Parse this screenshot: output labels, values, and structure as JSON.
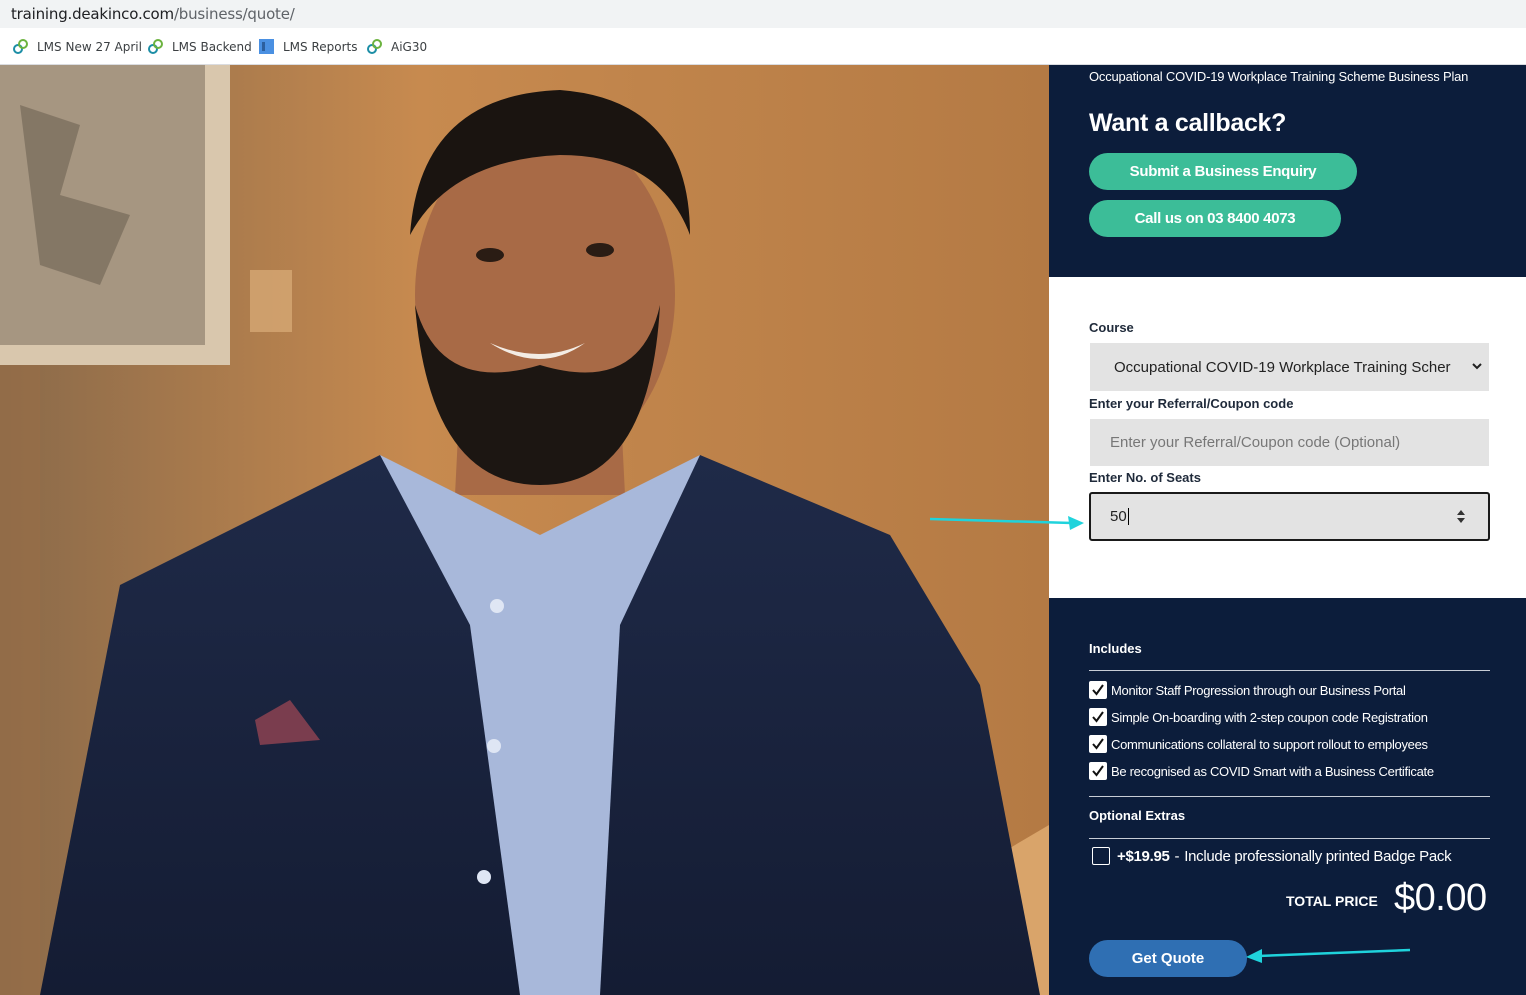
{
  "browser": {
    "url_host": "training.deakinco.com",
    "url_path": "/business/quote/",
    "bookmarks": [
      {
        "label": "LMS New 27 April",
        "icon": "chain-link-icon"
      },
      {
        "label": "LMS Backend",
        "icon": "chain-link-icon"
      },
      {
        "label": "LMS Reports",
        "icon": "report-icon"
      },
      {
        "label": "AiG30",
        "icon": "chain-link-icon"
      }
    ]
  },
  "hero": {
    "image": "photo of smiling bearded man in navy suit jacket"
  },
  "callback": {
    "plan_title": "Occupational COVID-19 Workplace Training Scheme Business Plan",
    "title": "Want a callback?",
    "enquiry_button": "Submit a Business Enquiry",
    "call_button": "Call us on 03 8400 4073"
  },
  "form": {
    "course_label": "Course",
    "course_value": "Occupational COVID-19 Workplace Training Scher",
    "coupon_label": "Enter your Referral/Coupon code",
    "coupon_placeholder": "Enter your Referral/Coupon code (Optional)",
    "seats_label": "Enter No. of Seats",
    "seats_value": "50"
  },
  "includes": {
    "label": "Includes",
    "items": [
      "Monitor Staff Progression through our Business Portal",
      "Simple On-boarding with 2-step coupon code Registration",
      "Communications collateral to support rollout to employees",
      "Be recognised as COVID Smart with a Business Certificate"
    ]
  },
  "extras": {
    "label": "Optional Extras",
    "price": "+$19.95",
    "separator": "-",
    "description": "Include professionally printed Badge Pack",
    "checked": false
  },
  "total": {
    "label": "TOTAL PRICE",
    "value": "$0.00"
  },
  "quote_button": "Get Quote",
  "colors": {
    "navy": "#0c1d3b",
    "green": "#3cbd98",
    "blue_button": "#2f6fb3",
    "annotation_arrow": "#1fd3dc"
  }
}
